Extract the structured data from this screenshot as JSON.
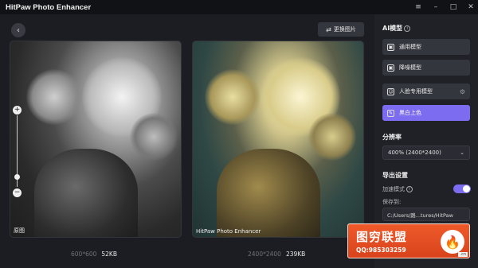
{
  "app": {
    "title": "HitPaw Photo Enhancer"
  },
  "window_controls": {
    "menu": "≡",
    "minimize": "–",
    "maximize": "□",
    "close": "✕"
  },
  "toolbar": {
    "back_icon": "‹",
    "replace_label": "更换图片",
    "replace_icon": "⇄"
  },
  "preview": {
    "original": {
      "label": "原图",
      "dims": "600*600",
      "size": "52KB"
    },
    "enhanced": {
      "label": "HitPaw Photo Enhancer",
      "dims": "2400*2400",
      "size": "239KB"
    }
  },
  "zoom": {
    "plus": "+",
    "minus": "−"
  },
  "sidebar": {
    "ai_model_title": "AI模型",
    "info_icon": "i",
    "models": [
      {
        "label": "通用模型",
        "icon": "▣",
        "active": false
      },
      {
        "label": "降噪模型",
        "icon": "▣",
        "active": false
      },
      {
        "label": "人脸专用模型",
        "icon": "☺",
        "active": false,
        "gear": "⚙"
      },
      {
        "label": "黑白上色",
        "icon": "✎",
        "active": true
      }
    ],
    "resolution_title": "分辨率",
    "resolution_value": "400% (2400*2400)",
    "chevron": "⌄",
    "export_title": "导出设置",
    "accelerate_label": "加速模式",
    "accelerate_on": true,
    "save_to_label": "保存到:",
    "save_path": "C:/Users/路...tures/HitPaw"
  },
  "watermark": {
    "title": "图穷联盟",
    "qq": "QQ:985303259",
    "logo_icon": "flame-icon",
    "url": ".cn"
  },
  "colors": {
    "accent": "#7b6cf0",
    "watermark": "#e44a22"
  }
}
